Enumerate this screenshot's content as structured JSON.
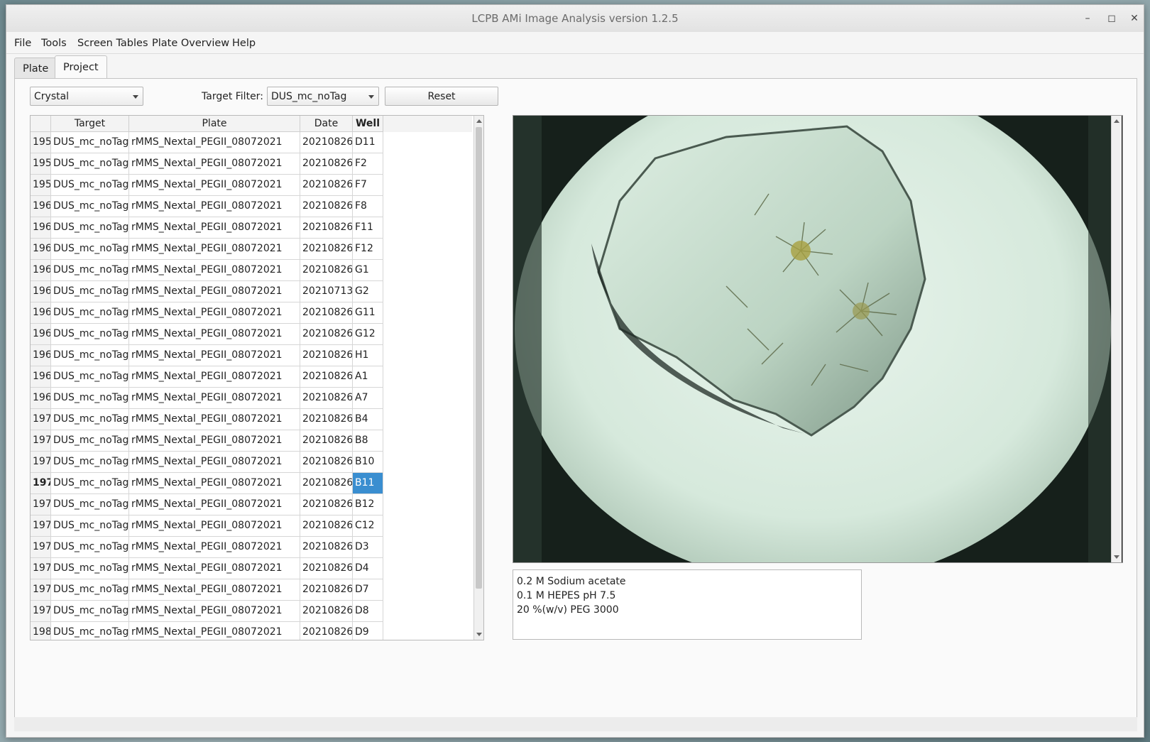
{
  "window": {
    "title": "LCPB AMi Image Analysis version 1.2.5"
  },
  "window_controls": {
    "minimize": "–",
    "maximize": "◻",
    "close": "✕"
  },
  "menu": [
    "File",
    "Tools",
    "Screen Tables",
    "Plate Overview",
    "Help"
  ],
  "tabs": [
    {
      "label": "Plate",
      "active": false
    },
    {
      "label": "Project",
      "active": true
    }
  ],
  "controls": {
    "category_select": "Crystal",
    "target_filter_label": "Target Filter:",
    "target_filter_value": "DUS_mc_noTag",
    "reset_label": "Reset"
  },
  "table": {
    "columns": [
      "Target",
      "Plate",
      "Date",
      "Well"
    ],
    "selected_row_index": 16,
    "rows": [
      [
        "195",
        "DUS_mc_noTag",
        "rMMS_Nextal_PEGII_08072021",
        "20210826",
        "D11"
      ],
      [
        "195",
        "DUS_mc_noTag",
        "rMMS_Nextal_PEGII_08072021",
        "20210826",
        "F2"
      ],
      [
        "195",
        "DUS_mc_noTag",
        "rMMS_Nextal_PEGII_08072021",
        "20210826",
        "F7"
      ],
      [
        "196",
        "DUS_mc_noTag",
        "rMMS_Nextal_PEGII_08072021",
        "20210826",
        "F8"
      ],
      [
        "196",
        "DUS_mc_noTag",
        "rMMS_Nextal_PEGII_08072021",
        "20210826",
        "F11"
      ],
      [
        "196",
        "DUS_mc_noTag",
        "rMMS_Nextal_PEGII_08072021",
        "20210826",
        "F12"
      ],
      [
        "196",
        "DUS_mc_noTag",
        "rMMS_Nextal_PEGII_08072021",
        "20210826",
        "G1"
      ],
      [
        "196",
        "DUS_mc_noTag",
        "rMMS_Nextal_PEGII_08072021",
        "20210713",
        "G2"
      ],
      [
        "196",
        "DUS_mc_noTag",
        "rMMS_Nextal_PEGII_08072021",
        "20210826",
        "G11"
      ],
      [
        "196",
        "DUS_mc_noTag",
        "rMMS_Nextal_PEGII_08072021",
        "20210826",
        "G12"
      ],
      [
        "196",
        "DUS_mc_noTag",
        "rMMS_Nextal_PEGII_08072021",
        "20210826",
        "H1"
      ],
      [
        "196",
        "DUS_mc_noTag",
        "rMMS_Nextal_PEGII_08072021",
        "20210826",
        "A1"
      ],
      [
        "196",
        "DUS_mc_noTag",
        "rMMS_Nextal_PEGII_08072021",
        "20210826",
        "A7"
      ],
      [
        "197",
        "DUS_mc_noTag",
        "rMMS_Nextal_PEGII_08072021",
        "20210826",
        "B4"
      ],
      [
        "197",
        "DUS_mc_noTag",
        "rMMS_Nextal_PEGII_08072021",
        "20210826",
        "B8"
      ],
      [
        "197",
        "DUS_mc_noTag",
        "rMMS_Nextal_PEGII_08072021",
        "20210826",
        "B10"
      ],
      [
        "197",
        "DUS_mc_noTag",
        "rMMS_Nextal_PEGII_08072021",
        "20210826",
        "B11"
      ],
      [
        "197",
        "DUS_mc_noTag",
        "rMMS_Nextal_PEGII_08072021",
        "20210826",
        "B12"
      ],
      [
        "197",
        "DUS_mc_noTag",
        "rMMS_Nextal_PEGII_08072021",
        "20210826",
        "C12"
      ],
      [
        "197",
        "DUS_mc_noTag",
        "rMMS_Nextal_PEGII_08072021",
        "20210826",
        "D3"
      ],
      [
        "197",
        "DUS_mc_noTag",
        "rMMS_Nextal_PEGII_08072021",
        "20210826",
        "D4"
      ],
      [
        "197",
        "DUS_mc_noTag",
        "rMMS_Nextal_PEGII_08072021",
        "20210826",
        "D7"
      ],
      [
        "197",
        "DUS_mc_noTag",
        "rMMS_Nextal_PEGII_08072021",
        "20210826",
        "D8"
      ],
      [
        "198",
        "DUS_mc_noTag",
        "rMMS_Nextal_PEGII_08072021",
        "20210826",
        "D9"
      ]
    ]
  },
  "conditions": [
    "0.2 M Sodium acetate",
    "0.1 M HEPES pH 7.5",
    "20 %(w/v) PEG 3000"
  ],
  "colors": {
    "selection": "#3a8ed0",
    "well_background": "#dfeee3"
  }
}
